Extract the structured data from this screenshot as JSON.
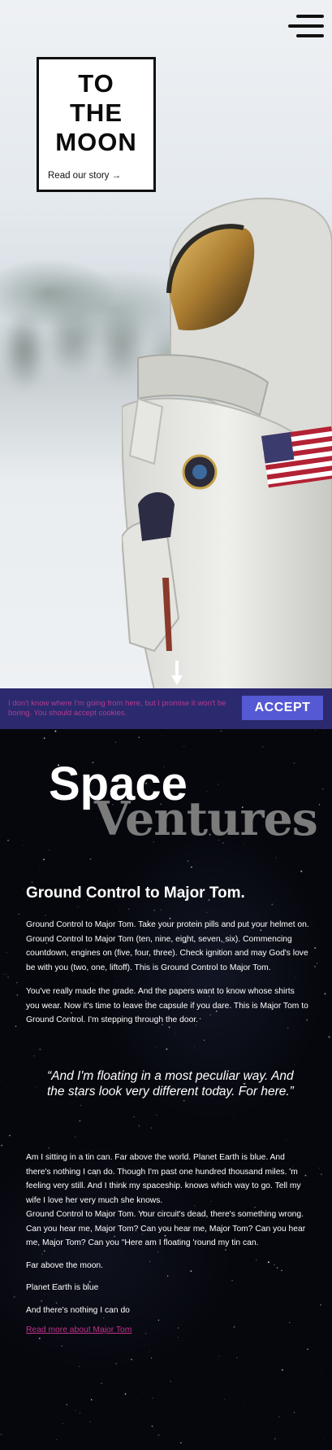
{
  "hero": {
    "title_lines": [
      "TO",
      "THE",
      "MOON"
    ],
    "story_link": "Read our story →"
  },
  "menu": {
    "icon": "hamburger-menu-icon"
  },
  "cookie": {
    "message": "I don't know where I'm going from here, but I promise it won't be boring. You should accept cookies.",
    "accept_label": "ACCEPT",
    "colors": {
      "bar": "#2b2a6e",
      "text": "#b43a8f",
      "button": "#5559d4"
    }
  },
  "brand": {
    "word1": "Space",
    "word2": "Ventures"
  },
  "article": {
    "heading": "Ground Control to Major Tom.",
    "paragraphs": [
      "Ground Control to Major Tom. Take your protein pills and put your helmet on. Ground Control to Major Tom (ten, nine, eight, seven, six). Commencing countdown, engines on (five, four, three). Check ignition and may God's love be with you (two, one, liftoff). This is Ground Control to Major Tom.",
      "You've really made the grade. And the papers want to know whose shirts you wear. Now it's time to leave the capsule if you dare. This is Major Tom to Ground Control. I'm stepping through the door."
    ],
    "quote": "“And I'm floating in a most peculiar way. And the stars look very different today. For here.”",
    "paragraph3": "Am I sitting in a tin can. Far above the world. Planet Earth is blue. And there's nothing I can do. Though I'm past one hundred thousand miles. 'm feeling very still. And I think my spaceship. knows which way to go. Tell my wife I love her very much she knows.",
    "paragraph4": "Ground Control to Major Tom. Your circuit's dead, there's something wrong. Can you hear me, Major Tom? Can you hear me, Major Tom? Can you hear me, Major Tom? Can you \"Here am I floating 'round my tin can.",
    "lines": [
      "Far above the moon.",
      "Planet Earth is blue",
      "And there's nothing I can do"
    ],
    "read_more": "Read more about Major Tom",
    "link_color": "#c2308e"
  }
}
